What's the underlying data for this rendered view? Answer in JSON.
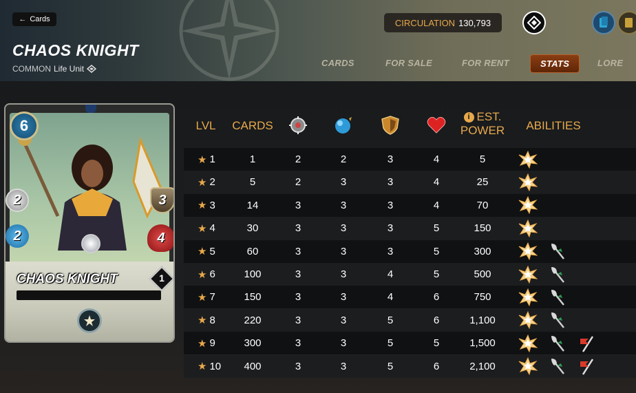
{
  "header": {
    "back_label": "Cards",
    "title": "CHAOS KNIGHT",
    "rarity": "COMMON",
    "unit_type": "Life Unit",
    "circulation_label": "CIRCULATION",
    "circulation_value": "130,793",
    "tabs": [
      {
        "label": "CARDS",
        "active": false
      },
      {
        "label": "FOR SALE",
        "active": false
      },
      {
        "label": "FOR RENT",
        "active": false
      },
      {
        "label": "STATS",
        "active": true
      },
      {
        "label": "LORE",
        "active": false
      }
    ]
  },
  "card": {
    "name": "CHAOS KNIGHT",
    "mana": "6",
    "melee": "2",
    "magic": "2",
    "armor": "3",
    "health": "4",
    "level": "1"
  },
  "table": {
    "headers": {
      "lvl": "LVL",
      "cards": "CARDS",
      "power_line1": "EST.",
      "power_line2": "POWER",
      "abilities": "ABILITIES"
    },
    "header_icons": [
      "melee-attack-icon",
      "magic-attack-icon",
      "armor-icon",
      "health-icon"
    ],
    "rows": [
      {
        "lvl": "1",
        "cards": "1",
        "melee": "2",
        "magic": "2",
        "armor": "3",
        "health": "4",
        "power": "5",
        "abilities": [
          "blast-icon"
        ]
      },
      {
        "lvl": "2",
        "cards": "5",
        "melee": "2",
        "magic": "3",
        "armor": "3",
        "health": "4",
        "power": "25",
        "abilities": [
          "blast-icon"
        ]
      },
      {
        "lvl": "3",
        "cards": "14",
        "melee": "3",
        "magic": "3",
        "armor": "3",
        "health": "4",
        "power": "70",
        "abilities": [
          "blast-icon"
        ]
      },
      {
        "lvl": "4",
        "cards": "30",
        "melee": "3",
        "magic": "3",
        "armor": "3",
        "health": "5",
        "power": "150",
        "abilities": [
          "blast-icon"
        ]
      },
      {
        "lvl": "5",
        "cards": "60",
        "melee": "3",
        "magic": "3",
        "armor": "3",
        "health": "5",
        "power": "300",
        "abilities": [
          "blast-icon",
          "axe-icon"
        ]
      },
      {
        "lvl": "6",
        "cards": "100",
        "melee": "3",
        "magic": "3",
        "armor": "4",
        "health": "5",
        "power": "500",
        "abilities": [
          "blast-icon",
          "axe-icon"
        ]
      },
      {
        "lvl": "7",
        "cards": "150",
        "melee": "3",
        "magic": "3",
        "armor": "4",
        "health": "6",
        "power": "750",
        "abilities": [
          "blast-icon",
          "axe-icon"
        ]
      },
      {
        "lvl": "8",
        "cards": "220",
        "melee": "3",
        "magic": "3",
        "armor": "5",
        "health": "6",
        "power": "1,100",
        "abilities": [
          "blast-icon",
          "axe-icon"
        ]
      },
      {
        "lvl": "9",
        "cards": "300",
        "melee": "3",
        "magic": "3",
        "armor": "5",
        "health": "5",
        "power": "1,500",
        "abilities": [
          "blast-icon",
          "axe-icon",
          "flag-icon"
        ]
      },
      {
        "lvl": "10",
        "cards": "400",
        "melee": "3",
        "magic": "3",
        "armor": "5",
        "health": "6",
        "power": "2,100",
        "abilities": [
          "blast-icon",
          "axe-icon",
          "flag-icon"
        ]
      }
    ]
  },
  "colors": {
    "accent": "#e8a94b",
    "active_tab": "#7a3510"
  }
}
